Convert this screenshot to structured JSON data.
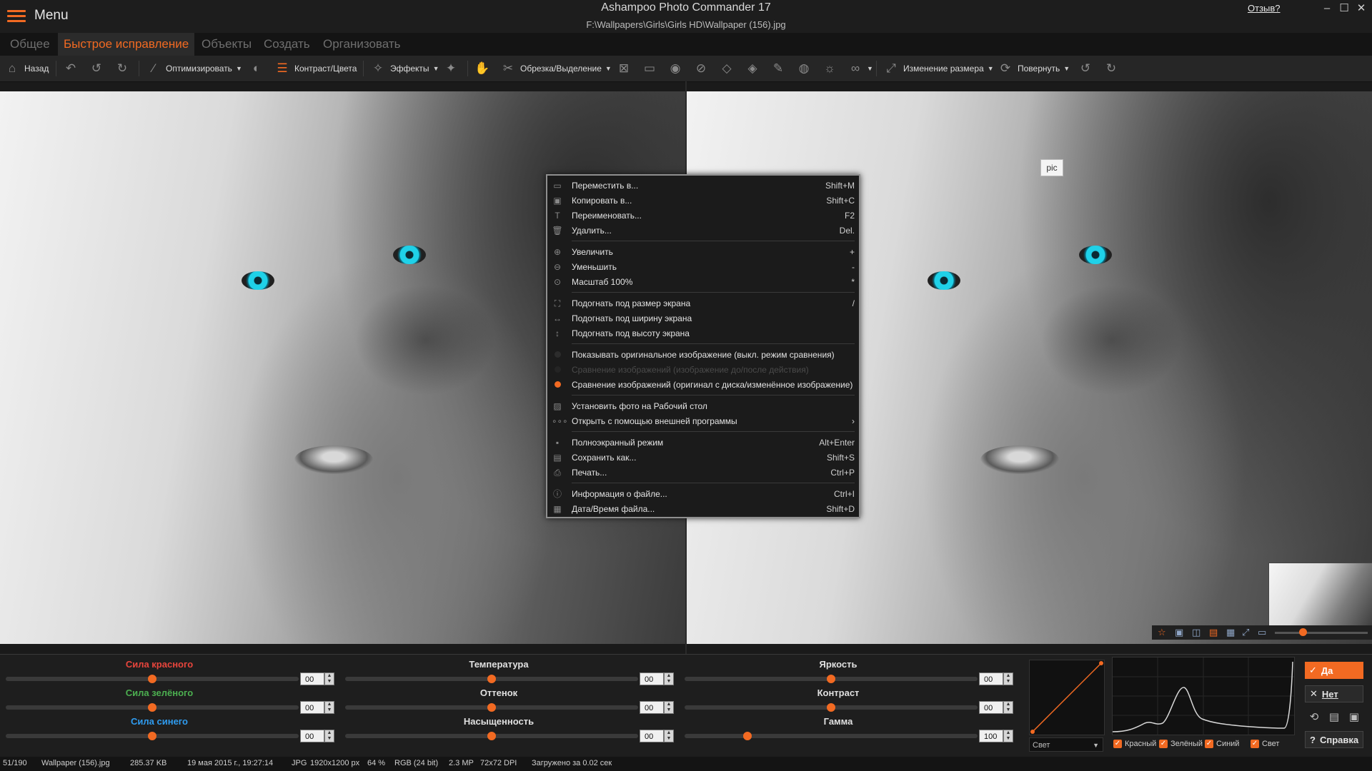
{
  "window": {
    "menu_label": "Menu",
    "app_title": "Ashampoo Photo Commander 17",
    "file_path": "F:\\Wallpapers\\Girls\\Girls HD\\Wallpaper (156).jpg",
    "feedback_link": "Отзыв?"
  },
  "tabs": [
    "Общее",
    "Быстрое исправление",
    "Объекты",
    "Создать",
    "Организовать"
  ],
  "toolbar": {
    "back": "Назад",
    "optimize": "Оптимизировать",
    "contrast": "Контраст/Цвета",
    "effects": "Эффекты",
    "crop": "Обрезка/Выделение",
    "resize": "Изменение размера",
    "rotate": "Повернуть"
  },
  "tooltip": "pic",
  "context_menu": {
    "items": [
      {
        "label": "Переместить в...",
        "shortcut": "Shift+M",
        "icon": "folder-move-icon"
      },
      {
        "label": "Копировать в...",
        "shortcut": "Shift+C",
        "icon": "folder-copy-icon"
      },
      {
        "label": "Переименовать...",
        "shortcut": "F2",
        "icon": "rename-icon"
      },
      {
        "label": "Удалить...",
        "shortcut": "Del.",
        "icon": "trash-icon"
      },
      {
        "label": "Увеличить",
        "shortcut": "+",
        "icon": "zoom-in-icon"
      },
      {
        "label": "Уменьшить",
        "shortcut": "-",
        "icon": "zoom-out-icon"
      },
      {
        "label": "Масштаб 100%",
        "shortcut": "*",
        "icon": "zoom-100-icon"
      },
      {
        "label": "Подогнать под размер экрана",
        "shortcut": "/",
        "icon": "fit-screen-icon"
      },
      {
        "label": "Подогнать под ширину экрана",
        "shortcut": "",
        "icon": "fit-width-icon"
      },
      {
        "label": "Подогнать под высоту экрана",
        "shortcut": "",
        "icon": "fit-height-icon"
      },
      {
        "label": "Показывать оригинальное изображение (выкл. режим сравнения)",
        "shortcut": "",
        "icon": "radio-off"
      },
      {
        "label": "Сравнение изображений (изображение до/после действия)",
        "shortcut": "",
        "icon": "radio-off"
      },
      {
        "label": "Сравнение изображений (оригинал с диска/изменённое изображение)",
        "shortcut": "",
        "icon": "radio-on"
      },
      {
        "label": "Установить фото на Рабочий стол",
        "shortcut": "",
        "icon": "wallpaper-icon"
      },
      {
        "label": "Открыть с помощью внешней программы",
        "shortcut": "›",
        "icon": "external-app-icon"
      },
      {
        "label": "Полноэкранный режим",
        "shortcut": "Alt+Enter",
        "icon": "fullscreen-icon"
      },
      {
        "label": "Сохранить как...",
        "shortcut": "Shift+S",
        "icon": "save-as-icon"
      },
      {
        "label": "Печать...",
        "shortcut": "Ctrl+P",
        "icon": "print-icon"
      },
      {
        "label": "Информация о файле...",
        "shortcut": "Ctrl+I",
        "icon": "info-icon"
      },
      {
        "label": "Дата/Время файла...",
        "shortcut": "Shift+D",
        "icon": "calendar-icon"
      }
    ]
  },
  "sliders": [
    {
      "label": "Сила красного",
      "value": "00",
      "level": 0.5,
      "color": "#e8453c"
    },
    {
      "label": "Сила зелёного",
      "value": "00",
      "level": 0.5,
      "color": "#4caf50"
    },
    {
      "label": "Сила синего",
      "value": "00",
      "level": 0.5,
      "color": "#2f9cf0"
    },
    {
      "label": "Температура",
      "value": "00",
      "level": 0.5,
      "color": "#e0e0e0"
    },
    {
      "label": "Оттенок",
      "value": "00",
      "level": 0.5,
      "color": "#e0e0e0"
    },
    {
      "label": "Насыщенность",
      "value": "00",
      "level": 0.5,
      "color": "#e0e0e0"
    },
    {
      "label": "Яркость",
      "value": "00",
      "level": 0.5,
      "color": "#e0e0e0"
    },
    {
      "label": "Контраст",
      "value": "00",
      "level": 0.5,
      "color": "#e0e0e0"
    },
    {
      "label": "Гамма",
      "value": "100",
      "level": 0.215,
      "color": "#e0e0e0"
    }
  ],
  "curve_select": "Свет",
  "channels": [
    "Красный",
    "Зелёный",
    "Синий",
    "Свет"
  ],
  "actions": {
    "yes": "Да",
    "no": "Нет",
    "help": "Справка"
  },
  "status": {
    "index": "51/190",
    "filename": "Wallpaper (156).jpg",
    "size": "285.37 KB",
    "date": "19 мая 2015 г., 19:27:14",
    "format": "JPG",
    "dimensions": "1920x1200 px",
    "zoom": "64 %",
    "color_mode": "RGB (24 bit)",
    "megapixels": "2.3 MP",
    "dpi": "72x72 DPI",
    "load_time": "Загружено за 0.02 сек"
  },
  "colors": {
    "accent": "#f26a22",
    "background": "#1a1a1a"
  }
}
